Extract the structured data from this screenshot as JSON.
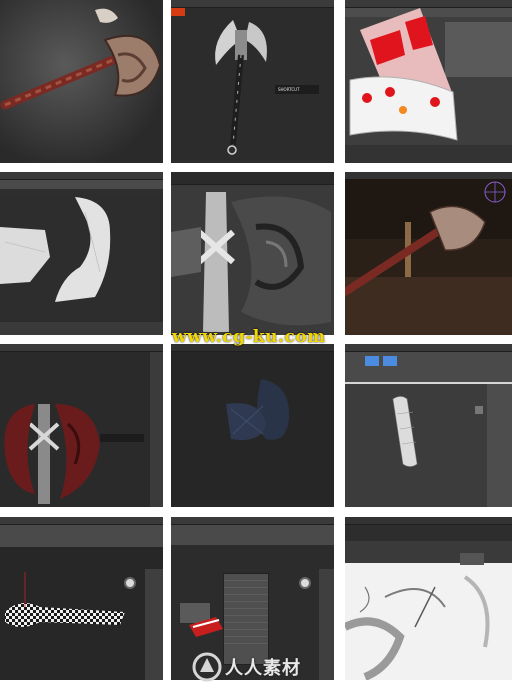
{
  "collage": {
    "tiles": [
      {
        "row": 1,
        "col": 1,
        "subject": "textured axe render"
      },
      {
        "row": 1,
        "col": 2,
        "subject": "axe with panel"
      },
      {
        "row": 1,
        "col": 3,
        "subject": "handle uv view"
      },
      {
        "row": 2,
        "col": 1,
        "subject": "white mesh viewport"
      },
      {
        "row": 2,
        "col": 2,
        "subject": "sculpt closeup"
      },
      {
        "row": 2,
        "col": 3,
        "subject": "axe in scene"
      },
      {
        "row": 3,
        "col": 1,
        "subject": "red axe viewport"
      },
      {
        "row": 3,
        "col": 2,
        "subject": "dark blue mesh"
      },
      {
        "row": 3,
        "col": 3,
        "subject": "handle mesh in max"
      },
      {
        "row": 4,
        "col": 1,
        "subject": "checker uv blade"
      },
      {
        "row": 4,
        "col": 2,
        "subject": "menu popup"
      },
      {
        "row": 4,
        "col": 3,
        "subject": "bake map white"
      }
    ]
  },
  "watermarks": {
    "top": "www.cg-ku.com",
    "bottom": "人人素材"
  },
  "colors": {
    "viewport_dark": "#2b2b2b",
    "max_toolbar": "#3a3a3a",
    "watermark_yellow": "#f2d600",
    "uv_red": "#e0141c",
    "blade_red": "#6a1c1c"
  },
  "icons": [
    "axe-icon",
    "viewcube-icon",
    "gizmo-icon",
    "logo-mark-icon"
  ]
}
